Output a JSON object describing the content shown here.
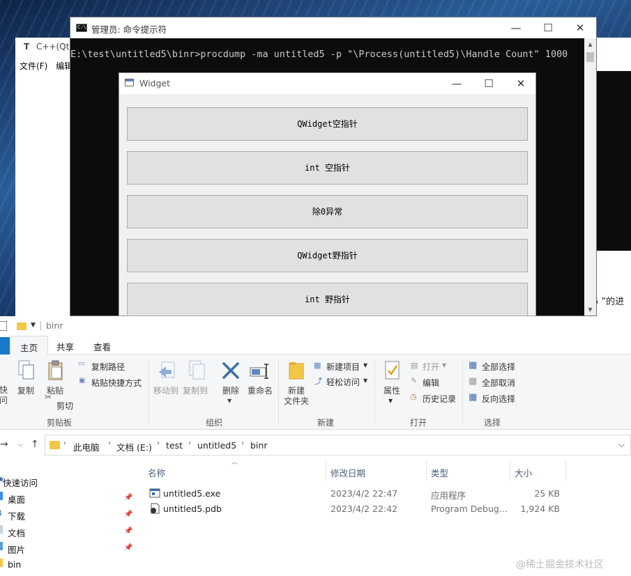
{
  "editor": {
    "icon_letter": "T",
    "title": "C++(Qt)",
    "menu": [
      "文件(F)",
      "编辑"
    ],
    "partial_text": "5 ”的进"
  },
  "cmd": {
    "title": "管理员: 命令提示符",
    "command": "E:\\test\\untitled5\\binr>procdump -ma untitled5 -p \"\\Process(untitled5)\\Handle Count\" 1000"
  },
  "widget": {
    "title": "Widget",
    "buttons": [
      "QWidget空指针",
      "int 空指针",
      "除0异常",
      "QWidget野指针",
      "int 野指针"
    ]
  },
  "window_controls": {
    "minimize": "—",
    "maximize": "☐",
    "close": "✕"
  },
  "explorer": {
    "title": "binr",
    "tabs": [
      "主页",
      "共享",
      "查看"
    ],
    "ribbon": {
      "clipboard": {
        "pin_label": "快\n问",
        "copy": "复制",
        "paste": "粘贴",
        "copy_path": "复制路径",
        "paste_shortcut": "粘贴快捷方式",
        "cut": "剪切",
        "group": "剪贴板"
      },
      "organize": {
        "move_to": "移动到",
        "copy_to": "复制到",
        "delete": "删除",
        "rename": "重命名",
        "group": "组织"
      },
      "new": {
        "new_folder": "新建\n文件夹",
        "new_item": "新建项目",
        "easy_access": "轻松访问",
        "group": "新建"
      },
      "open": {
        "properties": "属性",
        "open": "打开",
        "edit": "编辑",
        "history": "历史记录",
        "group": "打开"
      },
      "select": {
        "select_all": "全部选择",
        "select_none": "全部取消",
        "invert": "反向选择",
        "group": "选择"
      }
    },
    "path": [
      "此电脑",
      "文档 (E:)",
      "test",
      "untitled5",
      "binr"
    ],
    "nav": [
      "快速访问",
      "桌面",
      "下载",
      "文档",
      "图片",
      "bin"
    ],
    "columns": [
      "名称",
      "修改日期",
      "类型",
      "大小"
    ],
    "files": [
      {
        "name": "untitled5.exe",
        "date": "2023/4/2 22:47",
        "type": "应用程序",
        "size": "25 KB"
      },
      {
        "name": "untitled5.pdb",
        "date": "2023/4/2 22:42",
        "type": "Program Debug...",
        "size": "1,924 KB"
      }
    ]
  },
  "watermark": "@稀土掘金技术社区",
  "colors": {
    "cmd_bg": "#0c0c0c",
    "accent": "#1979ca",
    "folder": "#f3c648"
  }
}
